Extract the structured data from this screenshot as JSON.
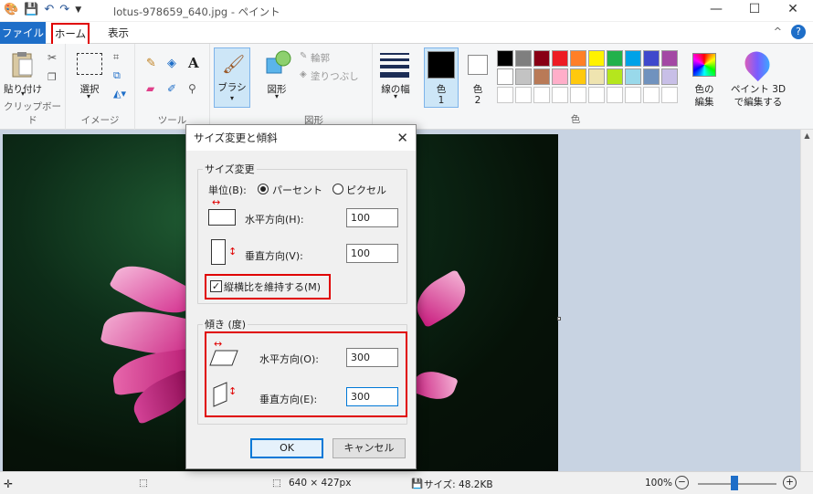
{
  "window": {
    "title": "lotus-978659_640.jpg - ペイント",
    "minimize": "—",
    "maximize": "☐",
    "close": "✕"
  },
  "menu": {
    "file": "ファイル",
    "home": "ホーム",
    "view": "表示",
    "help": "?",
    "collapse": "^"
  },
  "ribbon": {
    "clipboard": {
      "paste": "貼り付け",
      "label": "クリップボード"
    },
    "image": {
      "select": "選択",
      "label": "イメージ"
    },
    "tools": {
      "label": "ツール"
    },
    "brush": {
      "label": "ブラシ"
    },
    "shapes": {
      "shapes": "図形",
      "outline": "輪郭",
      "fill": "塗りつぶし",
      "label": "図形"
    },
    "linewidth": "線の幅",
    "color1": {
      "label": "色",
      "num": "1"
    },
    "color2": {
      "label": "色",
      "num": "2"
    },
    "edit_colors": {
      "line1": "色の",
      "line2": "編集"
    },
    "colors_label": "色",
    "paint3d": {
      "line1": "ペイント 3D",
      "line2": "で編集する"
    },
    "palette_row1": [
      "#000000",
      "#7f7f7f",
      "#880015",
      "#ed1c24",
      "#ff7f27",
      "#fff200",
      "#22b14c",
      "#00a2e8",
      "#3f48cc",
      "#a349a4"
    ],
    "palette_row2": [
      "#ffffff",
      "#c3c3c3",
      "#b97a57",
      "#ffaec9",
      "#ffc90e",
      "#efe4b0",
      "#b5e61d",
      "#99d9ea",
      "#7092be",
      "#c8bfe7"
    ],
    "palette_row3": [
      "#ffffff",
      "#ffffff",
      "#ffffff",
      "#ffffff",
      "#ffffff",
      "#ffffff",
      "#ffffff",
      "#ffffff",
      "#ffffff",
      "#ffffff"
    ]
  },
  "dialog": {
    "title": "サイズ変更と傾斜",
    "resize_legend": "サイズ変更",
    "unit_label": "単位(B):",
    "unit_percent": "パーセント",
    "unit_pixel": "ピクセル",
    "resize_h_label": "水平方向(H):",
    "resize_h_value": "100",
    "resize_v_label": "垂直方向(V):",
    "resize_v_value": "100",
    "keep_ratio": "縦横比を維持する(M)",
    "keep_ratio_checked": "✓",
    "skew_legend": "傾き (度)",
    "skew_h_label": "水平方向(O):",
    "skew_h_value": "300",
    "skew_v_label": "垂直方向(E):",
    "skew_v_value": "300",
    "ok": "OK",
    "cancel": "キャンセル"
  },
  "status": {
    "dimensions": "640 × 427px",
    "size": "サイズ: 48.2KB",
    "zoom": "100%"
  }
}
